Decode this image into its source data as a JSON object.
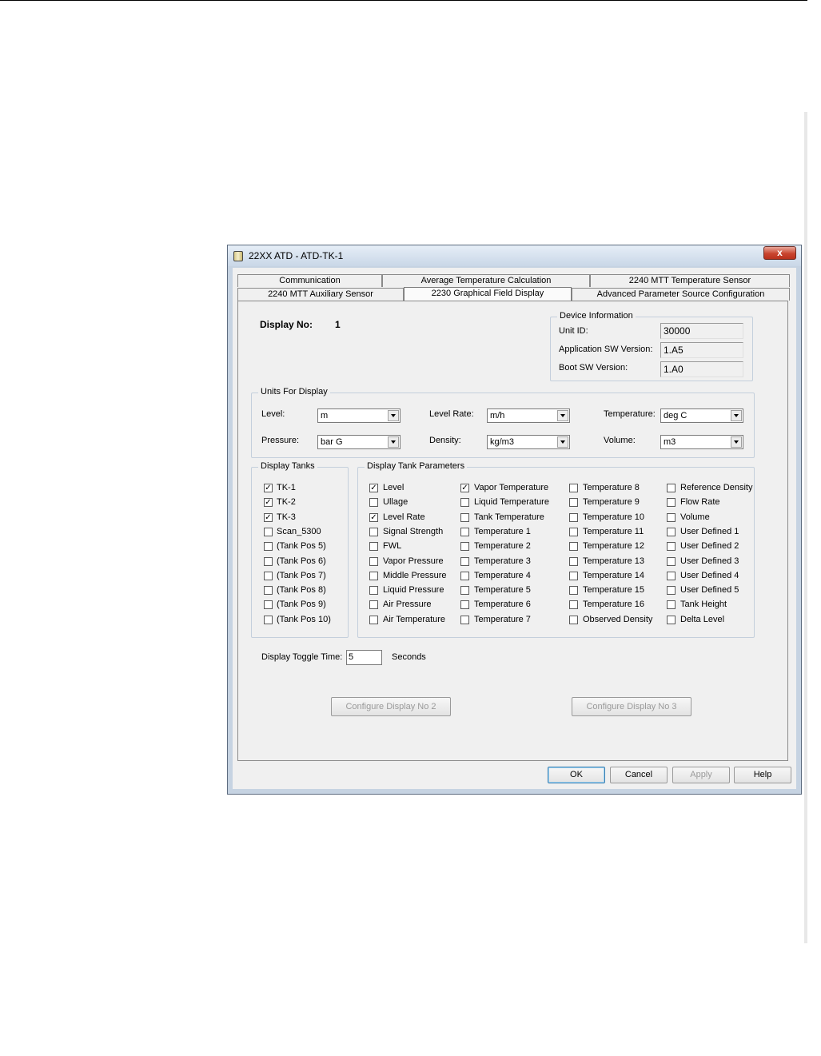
{
  "window": {
    "title": "22XX ATD  - ATD-TK-1",
    "close_label": "x"
  },
  "tabs": {
    "row1": [
      "Communication",
      "Average Temperature Calculation",
      "2240 MTT Temperature Sensor"
    ],
    "row2": [
      "2240 MTT Auxiliary Sensor",
      "2230 Graphical Field Display",
      "Advanced Parameter Source Configuration"
    ],
    "active": "2230 Graphical Field Display"
  },
  "display": {
    "label": "Display No:",
    "number": "1"
  },
  "device_info": {
    "legend": "Device Information",
    "unit_id_label": "Unit ID:",
    "unit_id": "30000",
    "app_sw_label": "Application SW Version:",
    "app_sw": "1.A5",
    "boot_sw_label": "Boot SW Version:",
    "boot_sw": "1.A0"
  },
  "units": {
    "legend": "Units For Display",
    "level_label": "Level:",
    "level": "m",
    "level_rate_label": "Level Rate:",
    "level_rate": "m/h",
    "temperature_label": "Temperature:",
    "temperature": "deg C",
    "pressure_label": "Pressure:",
    "pressure": "bar G",
    "density_label": "Density:",
    "density": "kg/m3",
    "volume_label": "Volume:",
    "volume": "m3"
  },
  "tanks": {
    "legend": "Display Tanks",
    "items": [
      {
        "label": "TK-1",
        "checked": true
      },
      {
        "label": "TK-2",
        "checked": true
      },
      {
        "label": "TK-3",
        "checked": true
      },
      {
        "label": "Scan_5300",
        "checked": false
      },
      {
        "label": "(Tank Pos 5)",
        "checked": false
      },
      {
        "label": "(Tank Pos 6)",
        "checked": false
      },
      {
        "label": "(Tank Pos 7)",
        "checked": false
      },
      {
        "label": "(Tank Pos 8)",
        "checked": false
      },
      {
        "label": "(Tank Pos 9)",
        "checked": false
      },
      {
        "label": "(Tank Pos 10)",
        "checked": false
      }
    ]
  },
  "params": {
    "legend": "Display Tank Parameters",
    "col1": [
      {
        "label": "Level",
        "checked": true
      },
      {
        "label": "Ullage",
        "checked": false
      },
      {
        "label": "Level Rate",
        "checked": true
      },
      {
        "label": "Signal Strength",
        "checked": false
      },
      {
        "label": "FWL",
        "checked": false
      },
      {
        "label": "Vapor Pressure",
        "checked": false
      },
      {
        "label": "Middle Pressure",
        "checked": false
      },
      {
        "label": "Liquid Pressure",
        "checked": false
      },
      {
        "label": "Air Pressure",
        "checked": false
      },
      {
        "label": "Air Temperature",
        "checked": false
      }
    ],
    "col2": [
      {
        "label": "Vapor Temperature",
        "checked": true
      },
      {
        "label": "Liquid Temperature",
        "checked": false
      },
      {
        "label": "Tank Temperature",
        "checked": false
      },
      {
        "label": "Temperature 1",
        "checked": false
      },
      {
        "label": "Temperature 2",
        "checked": false
      },
      {
        "label": "Temperature 3",
        "checked": false
      },
      {
        "label": "Temperature 4",
        "checked": false
      },
      {
        "label": "Temperature 5",
        "checked": false
      },
      {
        "label": "Temperature 6",
        "checked": false
      },
      {
        "label": "Temperature 7",
        "checked": false
      }
    ],
    "col3": [
      {
        "label": "Temperature 8",
        "checked": false
      },
      {
        "label": "Temperature 9",
        "checked": false
      },
      {
        "label": "Temperature 10",
        "checked": false
      },
      {
        "label": "Temperature 11",
        "checked": false
      },
      {
        "label": "Temperature 12",
        "checked": false
      },
      {
        "label": "Temperature 13",
        "checked": false
      },
      {
        "label": "Temperature 14",
        "checked": false
      },
      {
        "label": "Temperature 15",
        "checked": false
      },
      {
        "label": "Temperature 16",
        "checked": false
      },
      {
        "label": "Observed Density",
        "checked": false
      }
    ],
    "col4": [
      {
        "label": "Reference Density",
        "checked": false
      },
      {
        "label": "Flow Rate",
        "checked": false
      },
      {
        "label": "Volume",
        "checked": false
      },
      {
        "label": "User Defined 1",
        "checked": false
      },
      {
        "label": "User Defined 2",
        "checked": false
      },
      {
        "label": "User Defined 3",
        "checked": false
      },
      {
        "label": "User Defined 4",
        "checked": false
      },
      {
        "label": "User Defined 5",
        "checked": false
      },
      {
        "label": "Tank Height",
        "checked": false
      },
      {
        "label": "Delta Level",
        "checked": false
      }
    ]
  },
  "toggle": {
    "label": "Display Toggle Time:",
    "value": "5",
    "unit": "Seconds"
  },
  "buttons": {
    "configure2": "Configure Display No 2",
    "configure3": "Configure Display No 3",
    "ok": "OK",
    "cancel": "Cancel",
    "apply": "Apply",
    "help": "Help"
  },
  "check_mark": "✓"
}
